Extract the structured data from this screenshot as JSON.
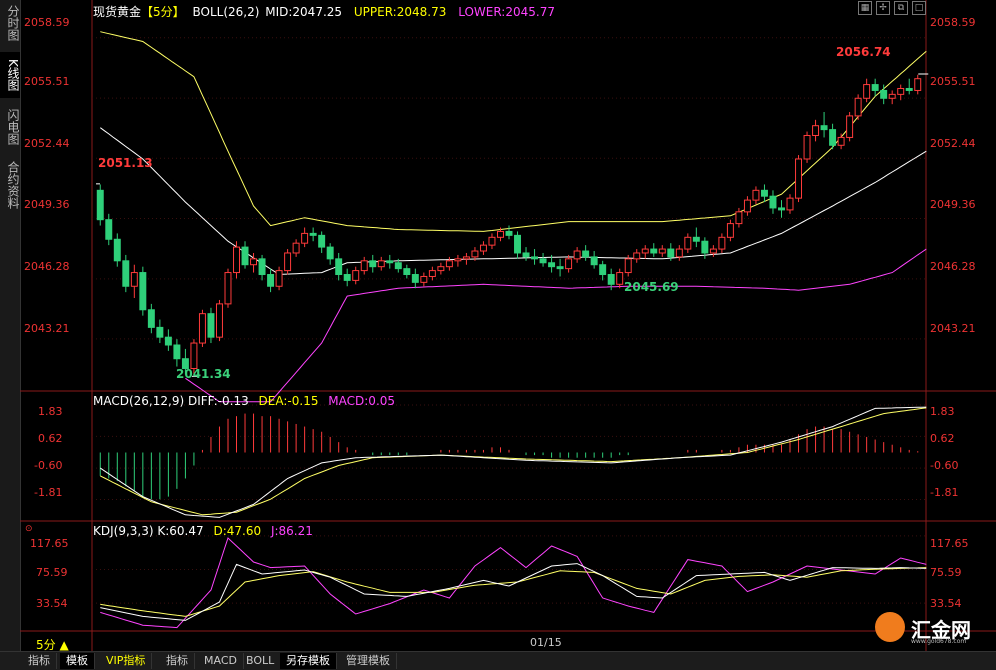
{
  "sidebar": {
    "tabs": [
      "分时图",
      "K线图",
      "闪电图",
      "合约资料"
    ],
    "active": 1
  },
  "toolbar_icons": [
    "grid-icon",
    "cross-icon",
    "restore-icon",
    "maximize-icon"
  ],
  "main_header": {
    "symbol": "现货黄金",
    "period": "【5分】",
    "boll": "BOLL(26,2)",
    "mid": "MID:2047.25",
    "upper": "UPPER:2048.73",
    "lower": "LOWER:2045.77"
  },
  "macd_header": {
    "name": "MACD(26,12,9)",
    "diff": "DIFF:-0.13",
    "dea": "DEA:-0.15",
    "macd": "MACD:0.05"
  },
  "kdj_header": {
    "name": "KDJ(9,3,3)",
    "k": "K:60.47",
    "d": "D:47.60",
    "j": "J:86.21"
  },
  "axes": {
    "price_ticks": [
      "2058.59",
      "2055.51",
      "2052.44",
      "2049.36",
      "2046.28",
      "2043.21"
    ],
    "macd_ticks": [
      "1.83",
      "0.62",
      "-0.60",
      "-1.81"
    ],
    "kdj_ticks": [
      "117.65",
      "75.59",
      "33.54"
    ],
    "x_label": "01/15"
  },
  "annotations": {
    "high_left": "2051.13",
    "low": "2041.34",
    "low_mid": "2045.69",
    "high_right": "2056.74"
  },
  "bottom_tabs": [
    "指标",
    "模板",
    "VIP指标",
    "指标",
    "MACD",
    "BOLL",
    "另存模板",
    "管理模板"
  ],
  "period_selector": "5分",
  "logo": {
    "name": "汇金网",
    "url": "www.gold678.com"
  },
  "colors": {
    "up": "#ff3b3b",
    "down": "#2fd07a",
    "upper": "#ffff66",
    "mid": "#ffffff",
    "lower": "#ff44ff",
    "axis": "#e33333"
  },
  "chart_data": {
    "type": "candlestick",
    "price_range": [
      2040.5,
      2059.6
    ],
    "candles": [
      [
        2050.8,
        2051.1,
        2049.0,
        2049.3
      ],
      [
        2049.3,
        2049.6,
        2048.0,
        2048.3
      ],
      [
        2048.3,
        2048.6,
        2046.9,
        2047.2
      ],
      [
        2047.2,
        2047.5,
        2045.6,
        2045.9
      ],
      [
        2045.9,
        2047.0,
        2045.3,
        2046.6
      ],
      [
        2046.6,
        2046.9,
        2044.4,
        2044.7
      ],
      [
        2044.7,
        2045.0,
        2043.5,
        2043.8
      ],
      [
        2043.8,
        2044.2,
        2043.0,
        2043.3
      ],
      [
        2043.3,
        2043.7,
        2042.6,
        2042.9
      ],
      [
        2042.9,
        2043.2,
        2041.8,
        2042.2
      ],
      [
        2042.2,
        2042.7,
        2041.4,
        2041.7
      ],
      [
        2041.7,
        2043.2,
        2041.3,
        2043.0
      ],
      [
        2043.0,
        2044.7,
        2042.8,
        2044.5
      ],
      [
        2044.5,
        2044.8,
        2043.0,
        2043.3
      ],
      [
        2043.3,
        2045.2,
        2043.1,
        2045.0
      ],
      [
        2045.0,
        2046.8,
        2044.8,
        2046.6
      ],
      [
        2046.6,
        2048.2,
        2046.3,
        2047.9
      ],
      [
        2047.9,
        2048.2,
        2046.8,
        2047.0
      ],
      [
        2047.0,
        2047.6,
        2046.6,
        2047.3
      ],
      [
        2047.3,
        2047.5,
        2046.2,
        2046.5
      ],
      [
        2046.5,
        2046.8,
        2045.6,
        2045.9
      ],
      [
        2045.9,
        2046.9,
        2045.7,
        2046.7
      ],
      [
        2046.7,
        2047.8,
        2046.5,
        2047.6
      ],
      [
        2047.6,
        2048.3,
        2047.4,
        2048.1
      ],
      [
        2048.1,
        2048.9,
        2047.9,
        2048.6
      ],
      [
        2048.6,
        2048.9,
        2048.2,
        2048.5
      ],
      [
        2048.5,
        2048.7,
        2047.6,
        2047.9
      ],
      [
        2047.9,
        2048.1,
        2047.0,
        2047.3
      ],
      [
        2047.3,
        2047.6,
        2046.2,
        2046.5
      ],
      [
        2046.5,
        2046.8,
        2045.9,
        2046.2
      ],
      [
        2046.2,
        2046.9,
        2046.0,
        2046.7
      ],
      [
        2046.7,
        2047.4,
        2046.5,
        2047.2
      ],
      [
        2047.2,
        2047.5,
        2046.6,
        2046.9
      ],
      [
        2046.9,
        2047.4,
        2046.7,
        2047.2
      ],
      [
        2047.2,
        2047.5,
        2046.8,
        2047.1
      ],
      [
        2047.1,
        2047.3,
        2046.6,
        2046.8
      ],
      [
        2046.8,
        2047.0,
        2046.3,
        2046.5
      ],
      [
        2046.5,
        2046.8,
        2045.8,
        2046.1
      ],
      [
        2046.1,
        2046.6,
        2045.9,
        2046.4
      ],
      [
        2046.4,
        2046.9,
        2046.2,
        2046.7
      ],
      [
        2046.7,
        2047.1,
        2046.5,
        2046.9
      ],
      [
        2046.9,
        2047.4,
        2046.7,
        2047.2
      ],
      [
        2047.2,
        2047.5,
        2046.9,
        2047.3
      ],
      [
        2047.3,
        2047.6,
        2047.0,
        2047.4
      ],
      [
        2047.4,
        2047.9,
        2047.2,
        2047.7
      ],
      [
        2047.7,
        2048.2,
        2047.5,
        2048.0
      ],
      [
        2048.0,
        2048.6,
        2047.8,
        2048.4
      ],
      [
        2048.4,
        2048.9,
        2048.2,
        2048.7
      ],
      [
        2048.7,
        2049.0,
        2048.3,
        2048.5
      ],
      [
        2048.5,
        2048.7,
        2047.3,
        2047.6
      ],
      [
        2047.6,
        2047.9,
        2047.2,
        2047.4
      ],
      [
        2047.4,
        2047.8,
        2047.0,
        2047.3
      ],
      [
        2047.3,
        2047.6,
        2046.9,
        2047.1
      ],
      [
        2047.1,
        2047.5,
        2046.6,
        2046.9
      ],
      [
        2046.9,
        2047.3,
        2046.4,
        2046.8
      ],
      [
        2046.8,
        2047.5,
        2046.6,
        2047.3
      ],
      [
        2047.3,
        2047.9,
        2047.1,
        2047.7
      ],
      [
        2047.7,
        2048.0,
        2047.2,
        2047.4
      ],
      [
        2047.4,
        2047.7,
        2046.8,
        2047.0
      ],
      [
        2047.0,
        2047.2,
        2046.2,
        2046.5
      ],
      [
        2046.5,
        2046.8,
        2045.7,
        2046.0
      ],
      [
        2046.0,
        2046.8,
        2045.8,
        2046.6
      ],
      [
        2046.6,
        2047.5,
        2046.4,
        2047.3
      ],
      [
        2047.3,
        2047.8,
        2047.1,
        2047.6
      ],
      [
        2047.6,
        2048.0,
        2047.3,
        2047.8
      ],
      [
        2047.8,
        2048.1,
        2047.4,
        2047.6
      ],
      [
        2047.6,
        2048.0,
        2047.4,
        2047.8
      ],
      [
        2047.8,
        2048.1,
        2047.2,
        2047.4
      ],
      [
        2047.4,
        2048.0,
        2047.2,
        2047.8
      ],
      [
        2047.8,
        2048.6,
        2047.6,
        2048.4
      ],
      [
        2048.4,
        2048.9,
        2047.9,
        2048.2
      ],
      [
        2048.2,
        2048.4,
        2047.3,
        2047.6
      ],
      [
        2047.6,
        2048.0,
        2047.4,
        2047.8
      ],
      [
        2047.8,
        2048.6,
        2047.6,
        2048.4
      ],
      [
        2048.4,
        2049.3,
        2048.2,
        2049.1
      ],
      [
        2049.1,
        2049.9,
        2048.9,
        2049.7
      ],
      [
        2049.7,
        2050.5,
        2049.5,
        2050.3
      ],
      [
        2050.3,
        2051.0,
        2050.1,
        2050.8
      ],
      [
        2050.8,
        2051.1,
        2050.2,
        2050.5
      ],
      [
        2050.5,
        2050.8,
        2049.6,
        2049.9
      ],
      [
        2049.9,
        2050.3,
        2049.4,
        2049.8
      ],
      [
        2049.8,
        2050.6,
        2049.6,
        2050.4
      ],
      [
        2050.4,
        2052.6,
        2050.2,
        2052.4
      ],
      [
        2052.4,
        2053.8,
        2052.2,
        2053.6
      ],
      [
        2053.6,
        2054.4,
        2053.3,
        2054.1
      ],
      [
        2054.1,
        2054.8,
        2053.5,
        2053.9
      ],
      [
        2053.9,
        2054.2,
        2052.9,
        2053.1
      ],
      [
        2053.1,
        2053.7,
        2052.9,
        2053.5
      ],
      [
        2053.5,
        2054.8,
        2053.3,
        2054.6
      ],
      [
        2054.6,
        2055.7,
        2054.4,
        2055.5
      ],
      [
        2055.5,
        2056.5,
        2055.3,
        2056.2
      ],
      [
        2056.2,
        2056.5,
        2055.6,
        2055.9
      ],
      [
        2055.9,
        2056.2,
        2055.2,
        2055.5
      ],
      [
        2055.5,
        2055.9,
        2055.2,
        2055.7
      ],
      [
        2055.7,
        2056.2,
        2055.4,
        2056.0
      ],
      [
        2056.0,
        2056.5,
        2055.7,
        2055.9
      ],
      [
        2055.9,
        2056.7,
        2055.7,
        2056.5
      ]
    ],
    "boll_upper_guide": [
      [
        0,
        2058.9
      ],
      [
        5,
        2058.4
      ],
      [
        11,
        2056.6
      ],
      [
        15,
        2052.8
      ],
      [
        18,
        2050.0
      ],
      [
        20,
        2049.0
      ],
      [
        24,
        2049.4
      ],
      [
        29,
        2049.0
      ],
      [
        35,
        2048.8
      ],
      [
        45,
        2048.7
      ],
      [
        55,
        2049.2
      ],
      [
        66,
        2049.2
      ],
      [
        74,
        2049.5
      ],
      [
        80,
        2050.6
      ],
      [
        86,
        2053.0
      ],
      [
        91,
        2055.6
      ],
      [
        97,
        2057.9
      ]
    ],
    "boll_mid_guide": [
      [
        0,
        2054.0
      ],
      [
        5,
        2052.4
      ],
      [
        10,
        2050.2
      ],
      [
        15,
        2048.2
      ],
      [
        21,
        2046.5
      ],
      [
        26,
        2046.6
      ],
      [
        29,
        2047.1
      ],
      [
        35,
        2047.2
      ],
      [
        45,
        2047.3
      ],
      [
        55,
        2047.4
      ],
      [
        66,
        2047.3
      ],
      [
        74,
        2047.6
      ],
      [
        80,
        2048.6
      ],
      [
        86,
        2050.0
      ],
      [
        91,
        2051.2
      ],
      [
        97,
        2052.8
      ]
    ],
    "boll_lower_guide": [
      [
        10,
        2041.2
      ],
      [
        14,
        2040.0
      ],
      [
        20,
        2040.0
      ],
      [
        26,
        2043.0
      ],
      [
        29,
        2045.4
      ],
      [
        35,
        2045.8
      ],
      [
        45,
        2046.0
      ],
      [
        55,
        2045.8
      ],
      [
        62,
        2045.9
      ],
      [
        70,
        2045.9
      ],
      [
        78,
        2045.8
      ],
      [
        82,
        2045.7
      ],
      [
        88,
        2046.0
      ],
      [
        93,
        2046.6
      ],
      [
        97,
        2047.8
      ]
    ],
    "macd_range": [
      -2.6,
      2.1
    ],
    "macd_bars": [
      -0.9,
      -1.0,
      -1.1,
      -1.3,
      -1.5,
      -1.7,
      -1.8,
      -1.8,
      -1.7,
      -1.4,
      -1.0,
      -0.5,
      0.1,
      0.6,
      1.0,
      1.3,
      1.4,
      1.5,
      1.5,
      1.4,
      1.4,
      1.3,
      1.2,
      1.1,
      1.0,
      0.9,
      0.8,
      0.6,
      0.4,
      0.2,
      0.1,
      0.0,
      -0.1,
      -0.1,
      -0.1,
      -0.1,
      -0.1,
      0.0,
      0.0,
      0.0,
      0.1,
      0.1,
      0.1,
      0.1,
      0.1,
      0.1,
      0.2,
      0.2,
      0.1,
      0.0,
      -0.1,
      -0.1,
      -0.1,
      -0.2,
      -0.2,
      -0.2,
      -0.2,
      -0.2,
      -0.2,
      -0.2,
      -0.2,
      -0.1,
      -0.1,
      0.0,
      0.0,
      0.0,
      0.0,
      0.0,
      0.0,
      0.1,
      0.1,
      0.0,
      0.0,
      0.1,
      0.1,
      0.2,
      0.3,
      0.3,
      0.3,
      0.3,
      0.3,
      0.5,
      0.7,
      0.9,
      1.0,
      1.0,
      0.9,
      0.9,
      0.8,
      0.7,
      0.6,
      0.5,
      0.4,
      0.3,
      0.2,
      0.1,
      0.05
    ],
    "macd_diff_guide": [
      [
        0,
        -0.6
      ],
      [
        5,
        -1.7
      ],
      [
        10,
        -2.4
      ],
      [
        14,
        -2.5
      ],
      [
        18,
        -2.0
      ],
      [
        22,
        -1.0
      ],
      [
        26,
        -0.4
      ],
      [
        30,
        -0.2
      ],
      [
        40,
        -0.1
      ],
      [
        50,
        -0.3
      ],
      [
        60,
        -0.4
      ],
      [
        68,
        -0.2
      ],
      [
        74,
        -0.1
      ],
      [
        80,
        0.4
      ],
      [
        86,
        1.0
      ],
      [
        91,
        1.7
      ],
      [
        97,
        1.75
      ]
    ],
    "macd_dea_guide": [
      [
        0,
        -0.9
      ],
      [
        6,
        -1.9
      ],
      [
        12,
        -2.4
      ],
      [
        16,
        -2.3
      ],
      [
        20,
        -1.8
      ],
      [
        24,
        -1.0
      ],
      [
        28,
        -0.5
      ],
      [
        32,
        -0.2
      ],
      [
        40,
        -0.1
      ],
      [
        50,
        -0.25
      ],
      [
        60,
        -0.35
      ],
      [
        68,
        -0.2
      ],
      [
        76,
        0.0
      ],
      [
        82,
        0.5
      ],
      [
        88,
        1.1
      ],
      [
        92,
        1.5
      ],
      [
        97,
        1.72
      ]
    ],
    "kdj_range": [
      0,
      135
    ],
    "kdj_k_guide": [
      [
        0,
        28
      ],
      [
        5,
        17
      ],
      [
        10,
        12
      ],
      [
        14,
        35
      ],
      [
        16,
        82
      ],
      [
        19,
        70
      ],
      [
        24,
        75
      ],
      [
        27,
        66
      ],
      [
        31,
        45
      ],
      [
        36,
        42
      ],
      [
        41,
        52
      ],
      [
        45,
        62
      ],
      [
        48,
        55
      ],
      [
        53,
        80
      ],
      [
        56,
        83
      ],
      [
        59,
        68
      ],
      [
        63,
        42
      ],
      [
        66,
        40
      ],
      [
        70,
        68
      ],
      [
        74,
        70
      ],
      [
        78,
        72
      ],
      [
        81,
        62
      ],
      [
        86,
        78
      ],
      [
        91,
        77
      ],
      [
        94,
        78
      ],
      [
        97,
        77
      ]
    ],
    "kdj_d_guide": [
      [
        0,
        32
      ],
      [
        5,
        24
      ],
      [
        10,
        17
      ],
      [
        14,
        30
      ],
      [
        17,
        60
      ],
      [
        21,
        68
      ],
      [
        25,
        73
      ],
      [
        29,
        60
      ],
      [
        34,
        47
      ],
      [
        39,
        47
      ],
      [
        44,
        56
      ],
      [
        49,
        60
      ],
      [
        54,
        74
      ],
      [
        58,
        72
      ],
      [
        63,
        52
      ],
      [
        67,
        45
      ],
      [
        71,
        62
      ],
      [
        75,
        67
      ],
      [
        79,
        69
      ],
      [
        83,
        66
      ],
      [
        87,
        74
      ],
      [
        91,
        76
      ],
      [
        97,
        78
      ]
    ],
    "kdj_j_guide": [
      [
        0,
        22
      ],
      [
        5,
        6
      ],
      [
        9,
        3
      ],
      [
        13,
        50
      ],
      [
        15,
        115
      ],
      [
        18,
        85
      ],
      [
        20,
        78
      ],
      [
        24,
        80
      ],
      [
        27,
        45
      ],
      [
        30,
        20
      ],
      [
        34,
        33
      ],
      [
        38,
        50
      ],
      [
        41,
        40
      ],
      [
        44,
        80
      ],
      [
        47,
        103
      ],
      [
        50,
        78
      ],
      [
        53,
        105
      ],
      [
        56,
        92
      ],
      [
        59,
        40
      ],
      [
        62,
        30
      ],
      [
        65,
        22
      ],
      [
        69,
        88
      ],
      [
        73,
        80
      ],
      [
        76,
        48
      ],
      [
        79,
        60
      ],
      [
        83,
        80
      ],
      [
        87,
        75
      ],
      [
        91,
        70
      ],
      [
        94,
        90
      ],
      [
        97,
        82
      ]
    ]
  }
}
